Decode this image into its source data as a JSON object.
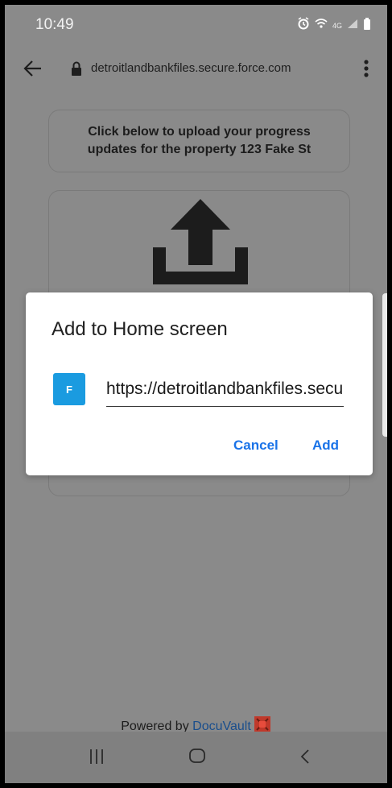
{
  "status_bar": {
    "time": "10:49",
    "icons": [
      "alarm-icon",
      "wifi-icon",
      "lte-icon",
      "signal-icon",
      "battery-icon"
    ],
    "network": "4G"
  },
  "address_bar": {
    "url": "detroitlandbankfiles.secure.force.com",
    "icons": [
      "back-arrow-icon",
      "lock-icon",
      "more-vert-icon"
    ]
  },
  "page": {
    "info_text": "Click below to upload your progress updates for the property 123 Fake St",
    "upload_icon": "upload-icon",
    "powered_prefix": "Powered by ",
    "powered_brand": "DocuVault",
    "brand_logo": "docuvault-logo"
  },
  "dialog": {
    "title": "Add to Home screen",
    "site_initial": "F",
    "url_value": "https://detroitlandbankfiles.secure.force.com",
    "cancel_label": "Cancel",
    "add_label": "Add"
  },
  "nav_bar": {
    "icons": [
      "recent-apps-icon",
      "home-icon",
      "back-icon"
    ]
  },
  "colors": {
    "overlay_bg": "#8a8a8a",
    "accent": "#1a73e8",
    "site_badge": "#1a9be0",
    "brand": "#1a4e8c"
  }
}
